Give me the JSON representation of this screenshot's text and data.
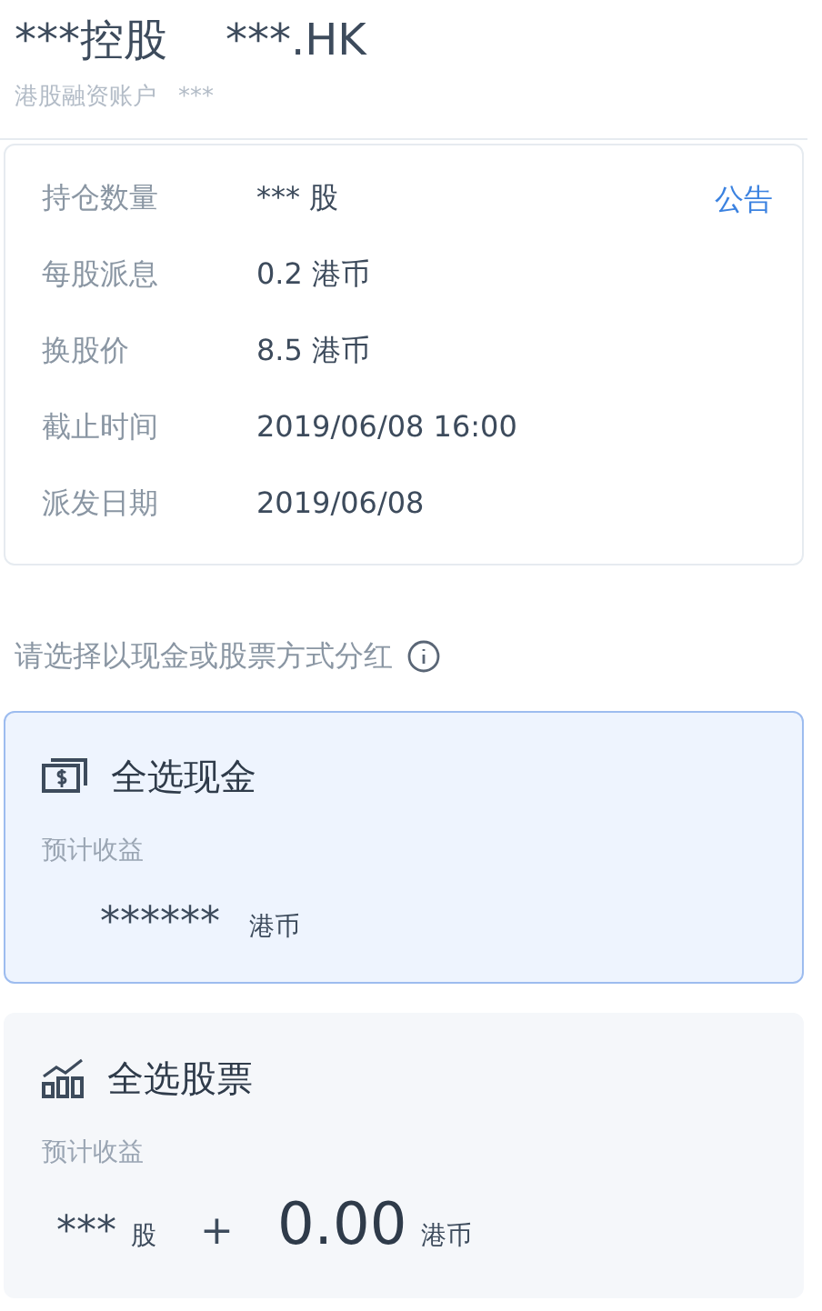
{
  "header": {
    "title": "***控股",
    "code": "***.HK",
    "account": "港股融资账户",
    "account_no": "***"
  },
  "details": {
    "link": "公告",
    "rows": [
      {
        "label": "持仓数量",
        "value": "*** 股"
      },
      {
        "label": "每股派息",
        "value": "0.2 港币"
      },
      {
        "label": "换股价",
        "value": "8.5 港币"
      },
      {
        "label": "截止时间",
        "value": "2019/06/08 16:00"
      },
      {
        "label": "派发日期",
        "value": "2019/06/08"
      }
    ]
  },
  "prompt": "请选择以现金或股票方式分红",
  "options": [
    {
      "kind": "cash",
      "title": "全选现金",
      "selected": true,
      "caption": "预计收益",
      "amount": "******",
      "unit": "港币"
    },
    {
      "kind": "stock",
      "title": "全选股票",
      "selected": false,
      "caption": "预计收益",
      "shares": "***",
      "shares_unit": "股",
      "plus": "+",
      "amount": "0.00",
      "unit": "港币"
    }
  ]
}
